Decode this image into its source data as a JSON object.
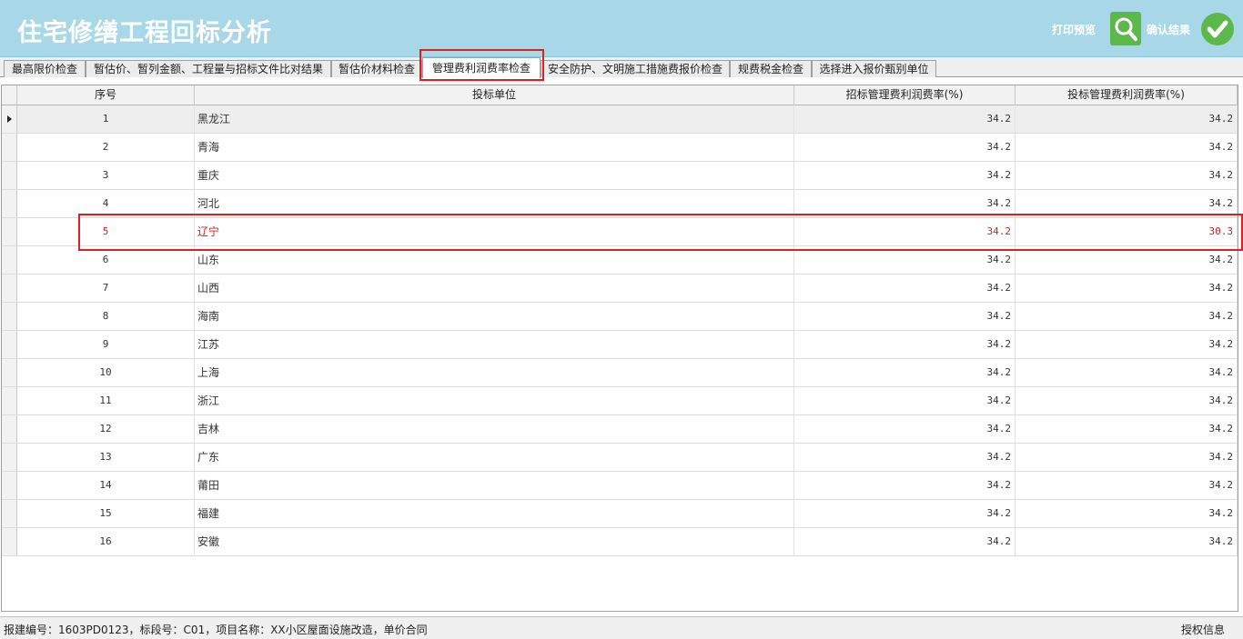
{
  "app": {
    "title": "住宅修缮工程回标分析",
    "print_label": "打印预览",
    "confirm_label": "确认结果"
  },
  "tabs": [
    {
      "label": "最高限价检查"
    },
    {
      "label": "暂估价、暂列金额、工程量与招标文件比对结果"
    },
    {
      "label": "暂估价材料检查"
    },
    {
      "label": "管理费利润费率检查",
      "active": true
    },
    {
      "label": "安全防护、文明施工措施费报价检查"
    },
    {
      "label": "规费税金检查"
    },
    {
      "label": "选择进入报价甄别单位"
    }
  ],
  "grid": {
    "columns": [
      "序号",
      "投标单位",
      "招标管理费利润费率(%)",
      "投标管理费利润费率(%)"
    ],
    "rows": [
      {
        "seq": "1",
        "unit": "黑龙江",
        "tender_rate": "34.2",
        "bid_rate": "34.2"
      },
      {
        "seq": "2",
        "unit": "青海",
        "tender_rate": "34.2",
        "bid_rate": "34.2"
      },
      {
        "seq": "3",
        "unit": "重庆",
        "tender_rate": "34.2",
        "bid_rate": "34.2"
      },
      {
        "seq": "4",
        "unit": "河北",
        "tender_rate": "34.2",
        "bid_rate": "34.2"
      },
      {
        "seq": "5",
        "unit": "辽宁",
        "tender_rate": "34.2",
        "bid_rate": "30.3"
      },
      {
        "seq": "6",
        "unit": "山东",
        "tender_rate": "34.2",
        "bid_rate": "34.2"
      },
      {
        "seq": "7",
        "unit": "山西",
        "tender_rate": "34.2",
        "bid_rate": "34.2"
      },
      {
        "seq": "8",
        "unit": "海南",
        "tender_rate": "34.2",
        "bid_rate": "34.2"
      },
      {
        "seq": "9",
        "unit": "江苏",
        "tender_rate": "34.2",
        "bid_rate": "34.2"
      },
      {
        "seq": "10",
        "unit": "上海",
        "tender_rate": "34.2",
        "bid_rate": "34.2"
      },
      {
        "seq": "11",
        "unit": "浙江",
        "tender_rate": "34.2",
        "bid_rate": "34.2"
      },
      {
        "seq": "12",
        "unit": "吉林",
        "tender_rate": "34.2",
        "bid_rate": "34.2"
      },
      {
        "seq": "13",
        "unit": "广东",
        "tender_rate": "34.2",
        "bid_rate": "34.2"
      },
      {
        "seq": "14",
        "unit": "莆田",
        "tender_rate": "34.2",
        "bid_rate": "34.2"
      },
      {
        "seq": "15",
        "unit": "福建",
        "tender_rate": "34.2",
        "bid_rate": "34.2"
      },
      {
        "seq": "16",
        "unit": "安徽",
        "tender_rate": "34.2",
        "bid_rate": "34.2"
      }
    ]
  },
  "status": {
    "text": "报建编号：1603PD0123，标段号：C01，项目名称：XX小区屋面设施改造，单价合同",
    "license": "授权信息"
  },
  "colors": {
    "header_bg": "#a8d8e8",
    "accent_green": "#5cb84a",
    "warning_red": "#cc2222",
    "highlight_box": "#e02020"
  },
  "icons": {
    "print": "search-icon",
    "confirm": "check-circle-icon",
    "row_pointer": "row-pointer-icon"
  }
}
